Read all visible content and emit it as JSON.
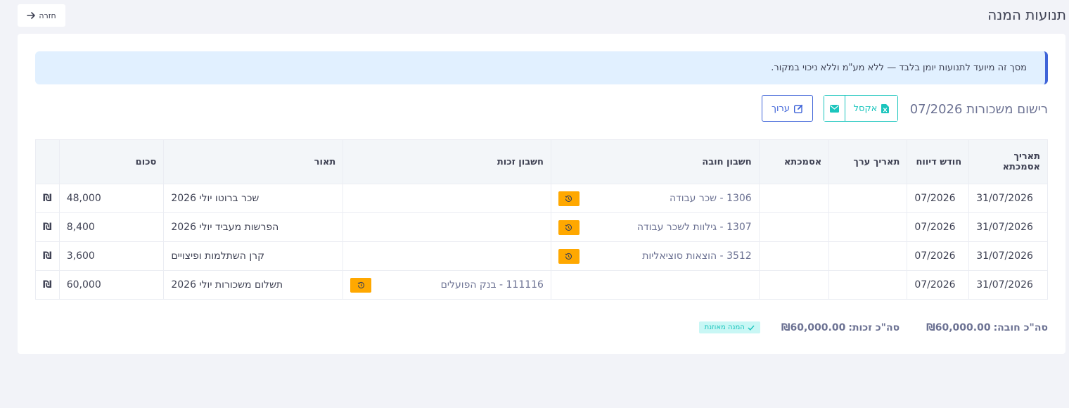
{
  "header": {
    "page_title": "תנועות המנה",
    "back_label": "חזרה"
  },
  "alert": {
    "text": "מסך זה מיועד לתנועות יומן בלבד — ללא מע\"מ וללא ניכוי במקור."
  },
  "batch": {
    "title": "רישום משכורות 07/2026",
    "excel_label": "אקסל",
    "edit_label": "ערוך"
  },
  "table": {
    "columns": [
      "תאריך אסמכתא",
      "חודש דיווח",
      "תאריך ערך",
      "אסמכתא",
      "חשבון חובה",
      "חשבון זכות",
      "תאור",
      "סכום",
      ""
    ],
    "rows": [
      {
        "date": "31/07/2026",
        "month": "07/2026",
        "value_date": "",
        "reference": "",
        "debit": "1306 - שכר עבודה",
        "credit": "",
        "description": "שכר ברוטו יולי 2026",
        "amount": "48,000",
        "currency": "₪"
      },
      {
        "date": "31/07/2026",
        "month": "07/2026",
        "value_date": "",
        "reference": "",
        "debit": "1307 - גילוות לשכר עבודה",
        "credit": "",
        "description": "הפרשות מעביד יולי 2026",
        "amount": "8,400",
        "currency": "₪"
      },
      {
        "date": "31/07/2026",
        "month": "07/2026",
        "value_date": "",
        "reference": "",
        "debit": "3512 - הוצאות סוציאליות",
        "credit": "",
        "description": "קרן השתלמות ופיצויים",
        "amount": "3,600",
        "currency": "₪"
      },
      {
        "date": "31/07/2026",
        "month": "07/2026",
        "value_date": "",
        "reference": "",
        "debit": "",
        "credit": "111116 - בנק הפועלים",
        "description": "תשלום משכורות יולי 2026",
        "amount": "60,000",
        "currency": "₪"
      }
    ]
  },
  "totals": {
    "debit_label": "סה\"כ חובה:",
    "debit_value": "₪60,000.00",
    "credit_label": "סה\"כ זכות:",
    "credit_value": "₪60,000.00",
    "balanced_label": "המנה מאוזנת"
  },
  "colors": {
    "primary": "#3f64d8",
    "success": "#1bc5bd",
    "warning": "#ffa800",
    "alert_bg": "#e1f0ff"
  },
  "icons": {
    "back": "arrow-right-icon",
    "excel": "file-excel-icon",
    "email": "envelope-icon",
    "edit": "pen-square-icon",
    "history": "history-icon",
    "check": "check-icon"
  }
}
